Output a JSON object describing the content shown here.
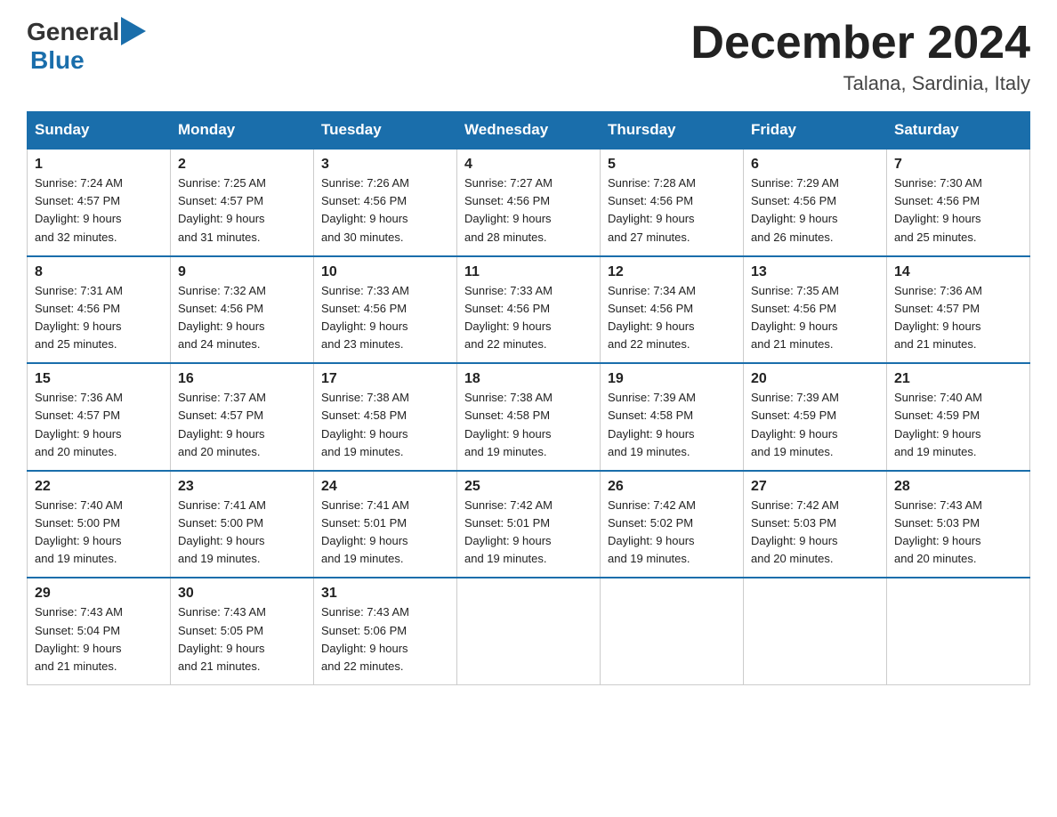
{
  "header": {
    "logo_general": "General",
    "logo_blue": "Blue",
    "month_title": "December 2024",
    "location": "Talana, Sardinia, Italy"
  },
  "days_of_week": [
    "Sunday",
    "Monday",
    "Tuesday",
    "Wednesday",
    "Thursday",
    "Friday",
    "Saturday"
  ],
  "weeks": [
    [
      {
        "day": "1",
        "sunrise": "7:24 AM",
        "sunset": "4:57 PM",
        "daylight": "9 hours and 32 minutes."
      },
      {
        "day": "2",
        "sunrise": "7:25 AM",
        "sunset": "4:57 PM",
        "daylight": "9 hours and 31 minutes."
      },
      {
        "day": "3",
        "sunrise": "7:26 AM",
        "sunset": "4:56 PM",
        "daylight": "9 hours and 30 minutes."
      },
      {
        "day": "4",
        "sunrise": "7:27 AM",
        "sunset": "4:56 PM",
        "daylight": "9 hours and 28 minutes."
      },
      {
        "day": "5",
        "sunrise": "7:28 AM",
        "sunset": "4:56 PM",
        "daylight": "9 hours and 27 minutes."
      },
      {
        "day": "6",
        "sunrise": "7:29 AM",
        "sunset": "4:56 PM",
        "daylight": "9 hours and 26 minutes."
      },
      {
        "day": "7",
        "sunrise": "7:30 AM",
        "sunset": "4:56 PM",
        "daylight": "9 hours and 25 minutes."
      }
    ],
    [
      {
        "day": "8",
        "sunrise": "7:31 AM",
        "sunset": "4:56 PM",
        "daylight": "9 hours and 25 minutes."
      },
      {
        "day": "9",
        "sunrise": "7:32 AM",
        "sunset": "4:56 PM",
        "daylight": "9 hours and 24 minutes."
      },
      {
        "day": "10",
        "sunrise": "7:33 AM",
        "sunset": "4:56 PM",
        "daylight": "9 hours and 23 minutes."
      },
      {
        "day": "11",
        "sunrise": "7:33 AM",
        "sunset": "4:56 PM",
        "daylight": "9 hours and 22 minutes."
      },
      {
        "day": "12",
        "sunrise": "7:34 AM",
        "sunset": "4:56 PM",
        "daylight": "9 hours and 22 minutes."
      },
      {
        "day": "13",
        "sunrise": "7:35 AM",
        "sunset": "4:56 PM",
        "daylight": "9 hours and 21 minutes."
      },
      {
        "day": "14",
        "sunrise": "7:36 AM",
        "sunset": "4:57 PM",
        "daylight": "9 hours and 21 minutes."
      }
    ],
    [
      {
        "day": "15",
        "sunrise": "7:36 AM",
        "sunset": "4:57 PM",
        "daylight": "9 hours and 20 minutes."
      },
      {
        "day": "16",
        "sunrise": "7:37 AM",
        "sunset": "4:57 PM",
        "daylight": "9 hours and 20 minutes."
      },
      {
        "day": "17",
        "sunrise": "7:38 AM",
        "sunset": "4:58 PM",
        "daylight": "9 hours and 19 minutes."
      },
      {
        "day": "18",
        "sunrise": "7:38 AM",
        "sunset": "4:58 PM",
        "daylight": "9 hours and 19 minutes."
      },
      {
        "day": "19",
        "sunrise": "7:39 AM",
        "sunset": "4:58 PM",
        "daylight": "9 hours and 19 minutes."
      },
      {
        "day": "20",
        "sunrise": "7:39 AM",
        "sunset": "4:59 PM",
        "daylight": "9 hours and 19 minutes."
      },
      {
        "day": "21",
        "sunrise": "7:40 AM",
        "sunset": "4:59 PM",
        "daylight": "9 hours and 19 minutes."
      }
    ],
    [
      {
        "day": "22",
        "sunrise": "7:40 AM",
        "sunset": "5:00 PM",
        "daylight": "9 hours and 19 minutes."
      },
      {
        "day": "23",
        "sunrise": "7:41 AM",
        "sunset": "5:00 PM",
        "daylight": "9 hours and 19 minutes."
      },
      {
        "day": "24",
        "sunrise": "7:41 AM",
        "sunset": "5:01 PM",
        "daylight": "9 hours and 19 minutes."
      },
      {
        "day": "25",
        "sunrise": "7:42 AM",
        "sunset": "5:01 PM",
        "daylight": "9 hours and 19 minutes."
      },
      {
        "day": "26",
        "sunrise": "7:42 AM",
        "sunset": "5:02 PM",
        "daylight": "9 hours and 19 minutes."
      },
      {
        "day": "27",
        "sunrise": "7:42 AM",
        "sunset": "5:03 PM",
        "daylight": "9 hours and 20 minutes."
      },
      {
        "day": "28",
        "sunrise": "7:43 AM",
        "sunset": "5:03 PM",
        "daylight": "9 hours and 20 minutes."
      }
    ],
    [
      {
        "day": "29",
        "sunrise": "7:43 AM",
        "sunset": "5:04 PM",
        "daylight": "9 hours and 21 minutes."
      },
      {
        "day": "30",
        "sunrise": "7:43 AM",
        "sunset": "5:05 PM",
        "daylight": "9 hours and 21 minutes."
      },
      {
        "day": "31",
        "sunrise": "7:43 AM",
        "sunset": "5:06 PM",
        "daylight": "9 hours and 22 minutes."
      },
      null,
      null,
      null,
      null
    ]
  ],
  "labels": {
    "sunrise": "Sunrise:",
    "sunset": "Sunset:",
    "daylight": "Daylight:"
  }
}
